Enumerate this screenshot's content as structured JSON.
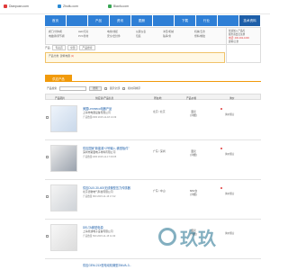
{
  "sites": [
    "Dianpuan.com",
    "Zhuifu.com",
    "Biaofu.com"
  ],
  "nav": [
    "首页",
    "",
    "产品",
    "资讯",
    "图册",
    "",
    "下载",
    "行业",
    "",
    "技术资料"
  ],
  "submenu": {
    "col1": [
      "阀门/分体阀",
      "电磁阀/调节阀"
    ],
    "col2": [
      "LED灯具",
      "PVC管材"
    ],
    "col3": [
      "电线/线缆",
      "安全/密封件"
    ],
    "col4": [
      "仪器仪表",
      "包装"
    ],
    "col5": [
      "冲压/机械",
      "轴承/泵"
    ],
    "col6": [
      "机械/五金",
      "塑料/橡胶"
    ]
  },
  "right_box": {
    "lines": [
      "欢迎加入产品库",
      "服务商会员注册",
      "电话: 400-032-1000",
      "建筑/五金"
    ]
  },
  "crumb": [
    "产品:",
    "专卖店",
    "全国",
    "产品搜索"
  ],
  "filter": {
    "label": "产品分类: 建筑电器",
    "highlight": "(1)"
  },
  "section_title": "供应产品",
  "toolbar": {
    "label1": "产品搜索",
    "btn": "搜索",
    "opt1": "",
    "opt2": "展示全部",
    "opt3": "按时间排序"
  },
  "thead": {
    "c1": "产品图片",
    "c2": "供应商/产品信息",
    "c3": "所在地",
    "c4": "产品价格",
    "c5": "",
    "c6": "询价"
  },
  "rows": [
    {
      "title": "美国Lenmeco电器产品",
      "company": "上海市电器设备有限公司",
      "meta": "产品数量2000  2015-11-18 14:49",
      "area": "北京 / 北京",
      "price": "面议",
      "price2": "[详细]",
      "ask": "询价留言"
    },
    {
      "title": "供应国家“新能源+2号输入-微型板件”",
      "company": "深圳市路面电子材料有限公司",
      "meta": "产品数量1000  2015-11-17 09:05",
      "area": "广东 / 深圳",
      "price": "面议",
      "price2": "[详细]",
      "ask": "询价留言"
    },
    {
      "title": "供应DUX-30-400无线微型压力传感器",
      "company": "北京德驰电气科技有限公司",
      "meta": "产品数量 800  2015-11-16 17:22",
      "area": "广东 / 中山",
      "price": "680/台",
      "price2": "[详细]",
      "ask": "询价留言"
    },
    {
      "title": "DELTA微型电源",
      "company": "上海星迪电子设备有限公司",
      "meta": "产品数量 500  2015-11-15 11:30",
      "area": "",
      "price": "面议",
      "price2": "[详细]",
      "ask": "询价留言"
    },
    {
      "title": "供应GEM-21X型电动机微型25kVA-3...",
      "company": "",
      "meta": "",
      "area": "",
      "price": "",
      "price2": "",
      "ask": ""
    }
  ],
  "watermark": "玖玖"
}
